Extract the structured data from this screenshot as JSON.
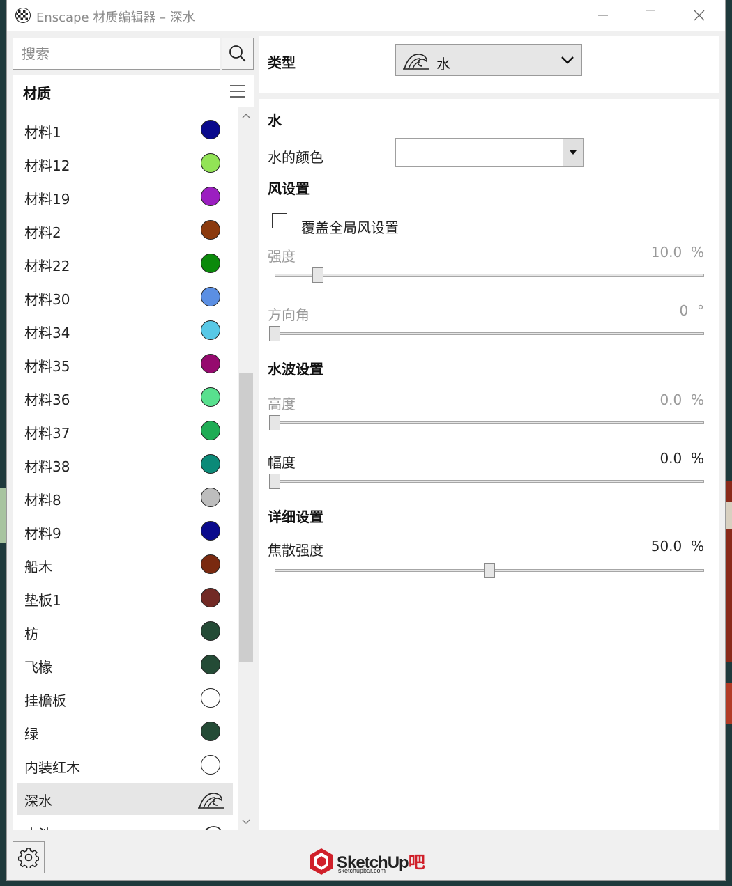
{
  "window": {
    "title": "Enscape 材质编辑器 – 深水"
  },
  "left": {
    "search_placeholder": "搜索",
    "materials_title": "材质",
    "materials": [
      {
        "name": "材料1",
        "color": "#0a0a8c",
        "icon": "swatch"
      },
      {
        "name": "材料12",
        "color": "#92e356",
        "icon": "swatch"
      },
      {
        "name": "材料19",
        "color": "#9b1fc0",
        "icon": "swatch"
      },
      {
        "name": "材料2",
        "color": "#8b3a0e",
        "icon": "swatch"
      },
      {
        "name": "材料22",
        "color": "#0b8a0b",
        "icon": "swatch"
      },
      {
        "name": "材料30",
        "color": "#5b8fe3",
        "icon": "swatch"
      },
      {
        "name": "材料34",
        "color": "#58c8e6",
        "icon": "swatch"
      },
      {
        "name": "材料35",
        "color": "#950a6e",
        "icon": "swatch"
      },
      {
        "name": "材料36",
        "color": "#58e08e",
        "icon": "swatch"
      },
      {
        "name": "材料37",
        "color": "#1fac55",
        "icon": "swatch"
      },
      {
        "name": "材料38",
        "color": "#0b8a78",
        "icon": "swatch"
      },
      {
        "name": "材料8",
        "color": "#bdbdbd",
        "icon": "swatch"
      },
      {
        "name": "材料9",
        "color": "#0a0a8c",
        "icon": "swatch"
      },
      {
        "name": "船木",
        "color": "#7a2a10",
        "icon": "swatch"
      },
      {
        "name": "垫板1",
        "color": "#722a25",
        "icon": "swatch"
      },
      {
        "name": "枋",
        "color": "#244b36",
        "icon": "swatch"
      },
      {
        "name": "飞椽",
        "color": "#244b36",
        "icon": "swatch"
      },
      {
        "name": "挂檐板",
        "color": "#ffffff",
        "icon": "swatch"
      },
      {
        "name": "绿",
        "color": "#244b36",
        "icon": "swatch"
      },
      {
        "name": "内装红木",
        "color": "#ffffff",
        "icon": "swatch"
      },
      {
        "name": "深水",
        "color": "",
        "icon": "water-wave-icon",
        "selected": true
      },
      {
        "name": "水池",
        "color": "",
        "icon": "water-wave-icon"
      }
    ]
  },
  "type": {
    "label": "类型",
    "value": "水"
  },
  "water": {
    "section": "水",
    "color_label": "水的颜色"
  },
  "wind": {
    "section": "风设置",
    "override_label": "覆盖全局风设置",
    "override_checked": false,
    "strength": {
      "label": "强度",
      "value": "10.0",
      "unit": "%",
      "fraction": 0.1
    },
    "direction": {
      "label": "方向角",
      "value": "0",
      "unit": "°",
      "fraction": 0.0
    }
  },
  "waves": {
    "section": "水波设置",
    "height": {
      "label": "高度",
      "value": "0.0",
      "unit": "%",
      "fraction": 0.0
    },
    "amplitude": {
      "label": "幅度",
      "value": "0.0",
      "unit": "%",
      "fraction": 0.0
    }
  },
  "detail": {
    "section": "详细设置",
    "caustics": {
      "label": "焦散强度",
      "value": "50.0",
      "unit": "%",
      "fraction": 0.5
    }
  },
  "logo": {
    "main_a": "SketchUp",
    "main_b": "吧",
    "sub": "sketchupbar.com"
  }
}
